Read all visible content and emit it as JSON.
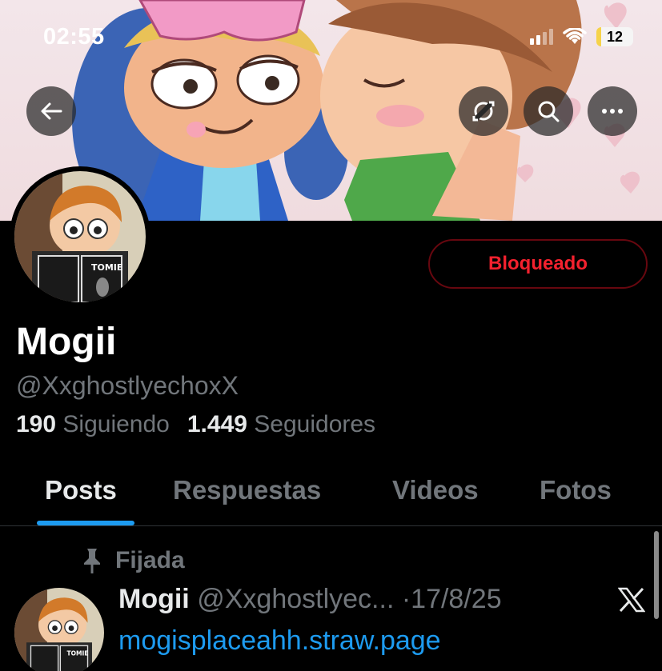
{
  "status_bar": {
    "time": "02:55",
    "battery": "12",
    "battery_level": 0.12
  },
  "header": {
    "back_icon": "arrow-left-icon",
    "refresh_icon": "refresh-icon",
    "search_icon": "search-icon",
    "more_icon": "more-horizontal-icon"
  },
  "profile": {
    "blocked_label": "Bloqueado",
    "name": "Mogii",
    "handle": "@XxghostlyechoxX",
    "following_count": "190",
    "following_label": "Siguiendo",
    "followers_count": "1.449",
    "followers_label": "Seguidores"
  },
  "tabs": [
    {
      "label": "Posts",
      "active": true
    },
    {
      "label": "Respuestas",
      "active": false
    },
    {
      "label": "Videos",
      "active": false
    },
    {
      "label": "Fotos",
      "active": false
    }
  ],
  "pinned_post": {
    "pinned_label": "Fijada",
    "author_name": "Mogii",
    "author_handle": "@Xxghostlyec...",
    "separator": "·",
    "date": "17/8/25",
    "link": "mogisplaceahh.straw.page"
  },
  "colors": {
    "accent": "#1d9bf0",
    "blocked_red": "#f4212e",
    "muted": "#71767b"
  }
}
